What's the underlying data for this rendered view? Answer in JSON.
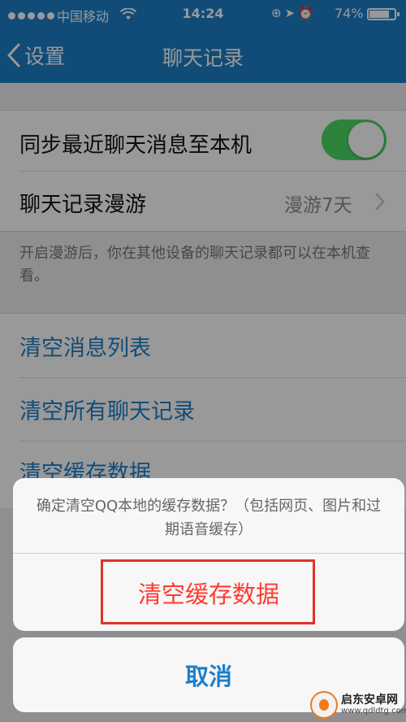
{
  "status_bar": {
    "carrier": "中国移动",
    "time": "14:24",
    "battery_percent": "74%",
    "battery_level": 0.74,
    "icons": [
      "signal-dots-icon",
      "wifi-icon",
      "orientation-lock-icon",
      "location-arrow-icon",
      "alarm-icon",
      "battery-icon"
    ]
  },
  "nav": {
    "back_label": "设置",
    "title": "聊天记录"
  },
  "settings": {
    "sync_label": "同步最近聊天消息至本机",
    "sync_on": true,
    "roaming_label": "聊天记录漫游",
    "roaming_value": "漫游7天",
    "note": "开启漫游后，你在其他设备的聊天记录都可以在本机查看。"
  },
  "actions": {
    "clear_message_list": "清空消息列表",
    "clear_all_chats": "清空所有聊天记录",
    "clear_cache": "清空缓存数据"
  },
  "action_sheet": {
    "message": "确定清空QQ本地的缓存数据？（包括网页、图片和过期语音缓存）",
    "confirm_label": "清空缓存数据",
    "cancel_label": "取消"
  },
  "colors": {
    "nav_bar": "#1d7fc9",
    "link": "#1d7fc9",
    "destructive": "#ff3b30",
    "toggle_on": "#4cd964",
    "highlight_box": "#e0332b"
  },
  "watermark": {
    "name": "启东安卓网",
    "url": "www.qdldtg.com"
  }
}
